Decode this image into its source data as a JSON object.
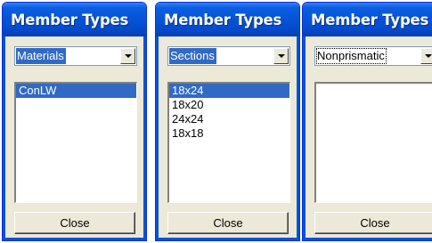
{
  "panels": [
    {
      "title": "Member Types",
      "dropdown": {
        "selected": "Materials"
      },
      "list": {
        "items": [
          "ConLW"
        ],
        "selected_index": 0
      },
      "close_label": "Close"
    },
    {
      "title": "Member Types",
      "dropdown": {
        "selected": "Sections"
      },
      "list": {
        "items": [
          "18x24",
          "18x20",
          "24x24",
          "18x18"
        ],
        "selected_index": 0
      },
      "close_label": "Close"
    },
    {
      "title": "Member Types",
      "dropdown": {
        "selected": "Nonprismatic"
      },
      "list": {
        "items": [],
        "selected_index": null
      },
      "close_label": "Close"
    }
  ],
  "icons": {
    "dropdown": "chevron-down-icon"
  },
  "colors": {
    "titlebar": "#0553d8",
    "selection": "#316ac5",
    "window_face": "#ece9d8"
  }
}
